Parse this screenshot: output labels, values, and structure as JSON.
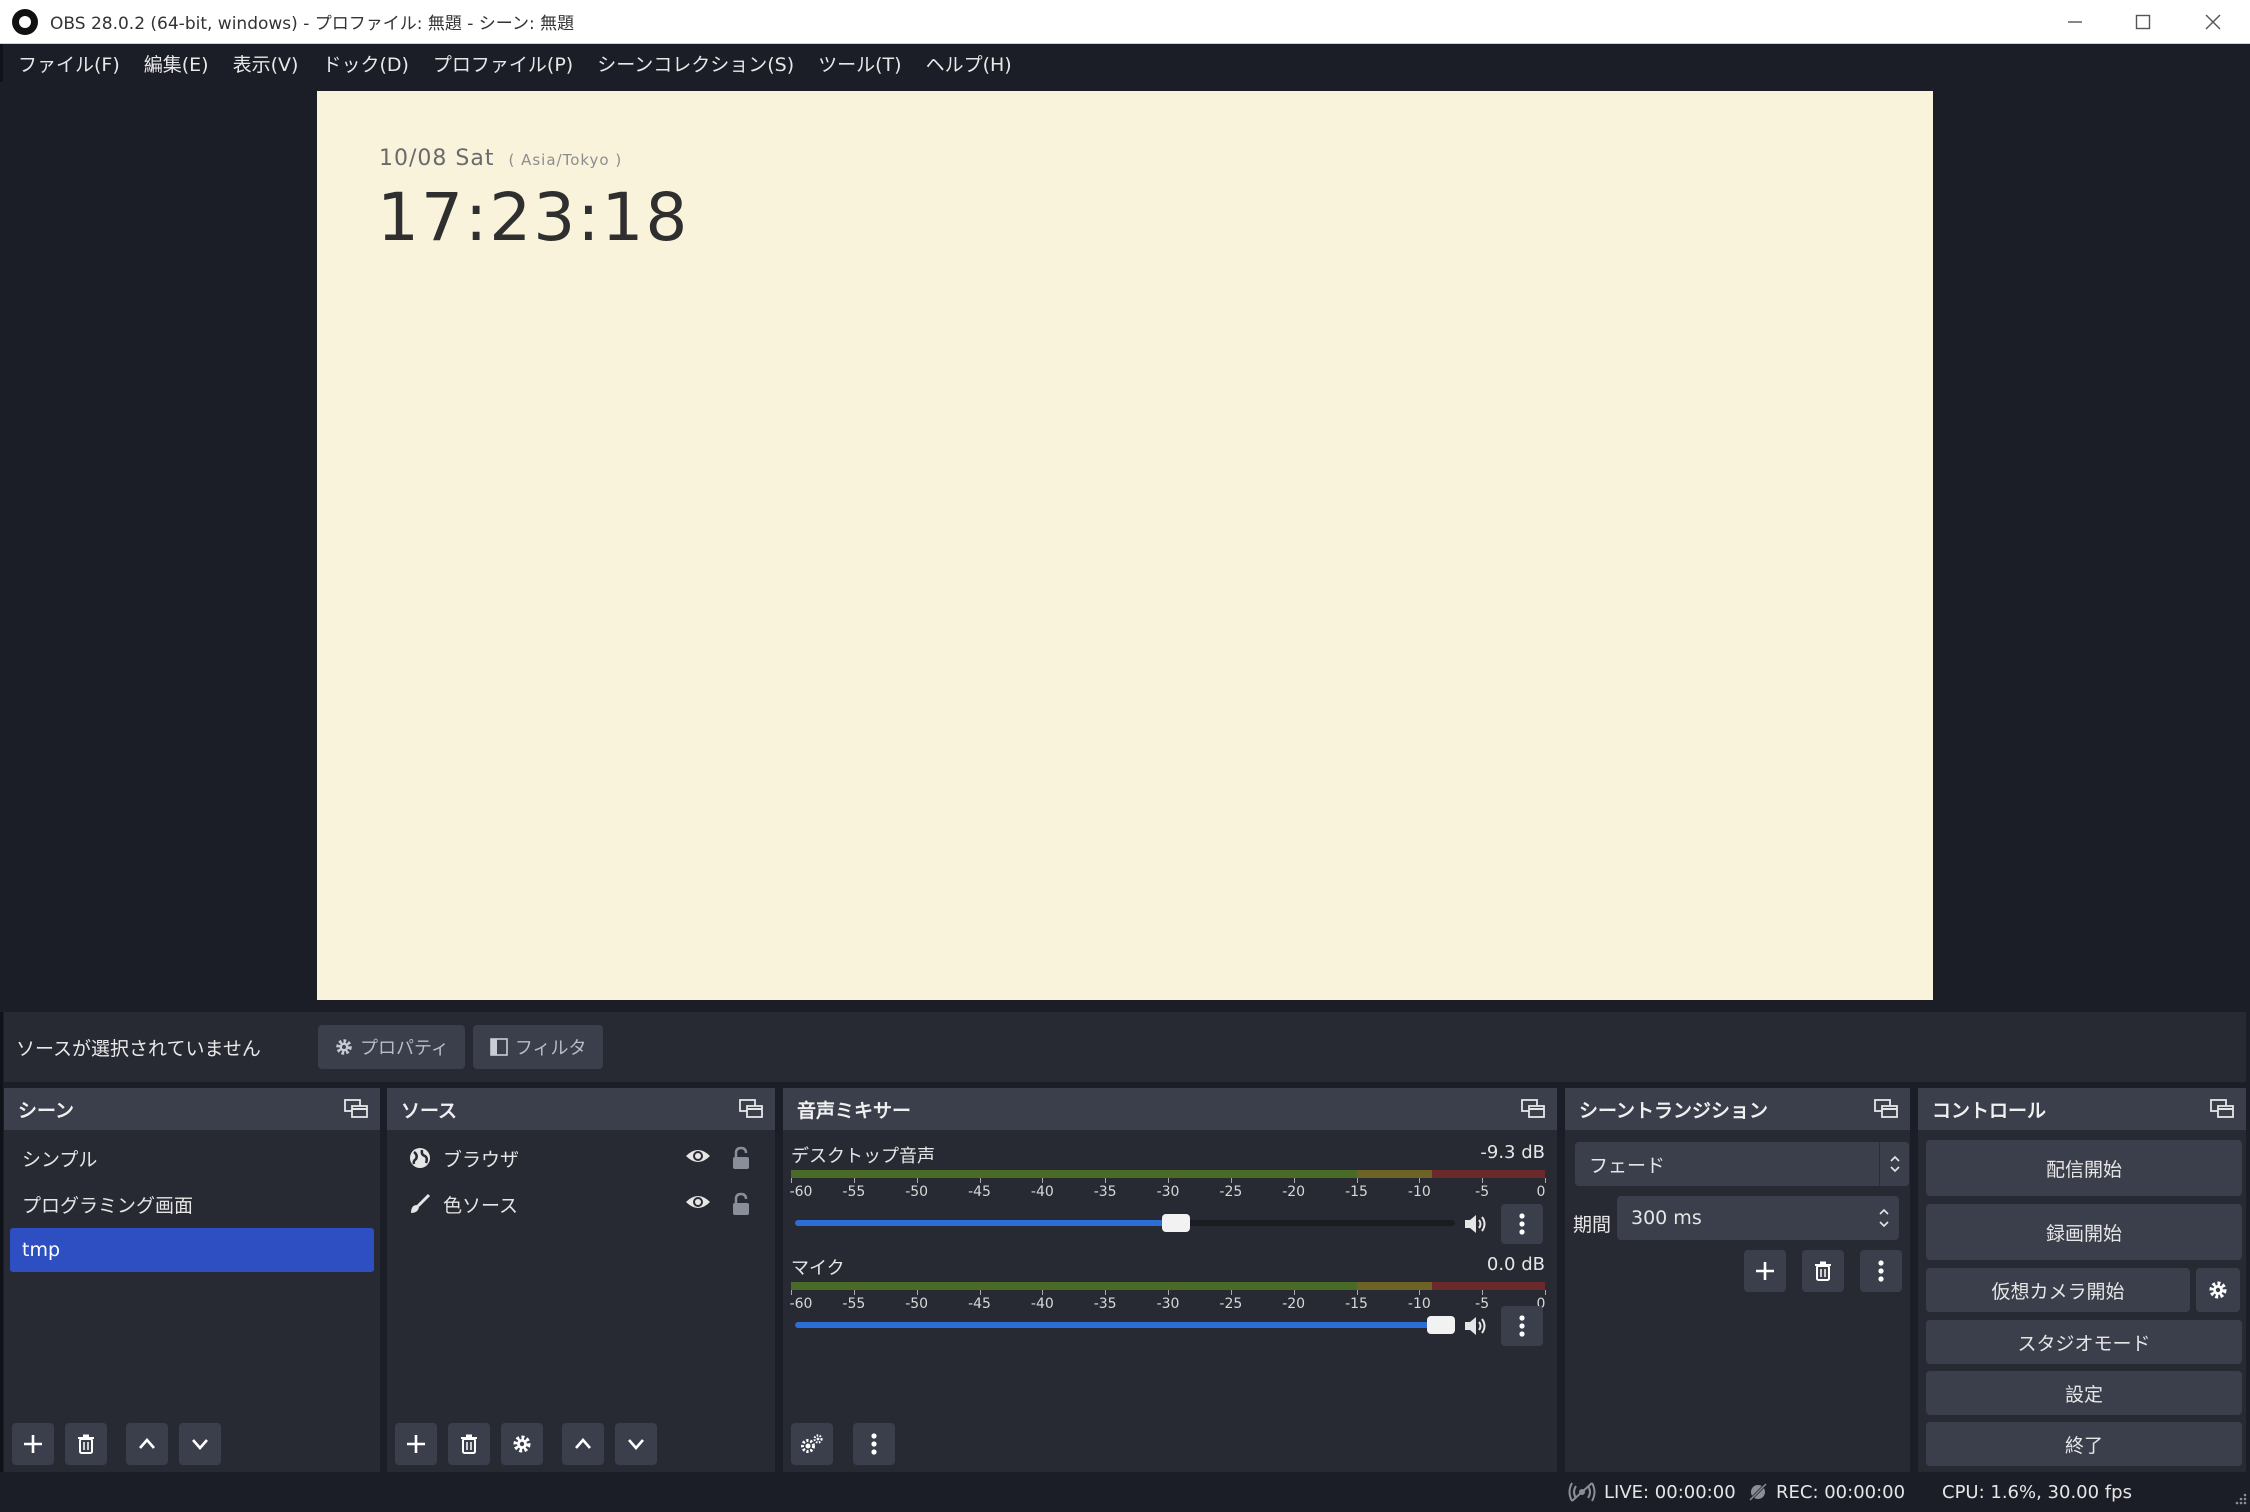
{
  "window": {
    "title": "OBS 28.0.2 (64-bit, windows) - プロファイル: 無題 - シーン: 無題"
  },
  "menu": [
    "ファイル(F)",
    "編集(E)",
    "表示(V)",
    "ドック(D)",
    "プロファイル(P)",
    "シーンコレクション(S)",
    "ツール(T)",
    "ヘルプ(H)"
  ],
  "preview": {
    "date": "10/08 Sat",
    "timezone": "( Asia/Tokyo )",
    "time": "17:23:18",
    "background": "#f9f3dc"
  },
  "context": {
    "no_source": "ソースが選択されていません",
    "properties": "プロパティ",
    "filters": "フィルタ"
  },
  "scenes": {
    "title": "シーン",
    "items": [
      "シンプル",
      "プログラミング画面",
      "tmp"
    ],
    "active_index": 2
  },
  "sources": {
    "title": "ソース",
    "items": [
      {
        "label": "ブラウザ",
        "icon": "globe-icon"
      },
      {
        "label": "色ソース",
        "icon": "paintbrush-icon"
      }
    ]
  },
  "mixer": {
    "title": "音声ミキサー",
    "ticks": [
      "-60",
      "-55",
      "-50",
      "-45",
      "-40",
      "-35",
      "-30",
      "-25",
      "-20",
      "-15",
      "-10",
      "-5",
      "0"
    ],
    "channels": [
      {
        "name": "デスクトップ音声",
        "db": "-9.3 dB",
        "volume": 0.58
      },
      {
        "name": "マイク",
        "db": "0.0 dB",
        "volume": 1.0
      }
    ]
  },
  "transitions": {
    "title": "シーントランジション",
    "selected": "フェード",
    "duration_label": "期間",
    "duration": "300 ms"
  },
  "controls": {
    "title": "コントロール",
    "start_stream": "配信開始",
    "start_record": "録画開始",
    "start_virtualcam": "仮想カメラ開始",
    "studio_mode": "スタジオモード",
    "settings": "設定",
    "exit": "終了"
  },
  "status": {
    "live": "LIVE: 00:00:00",
    "rec": "REC: 00:00:00",
    "cpu": "CPU: 1.6%, 30.00 fps"
  },
  "colors": {
    "accent": "#2d4fc2",
    "slider": "#2b6fd6",
    "panel": "#272a33",
    "button": "#3a3f4b"
  }
}
